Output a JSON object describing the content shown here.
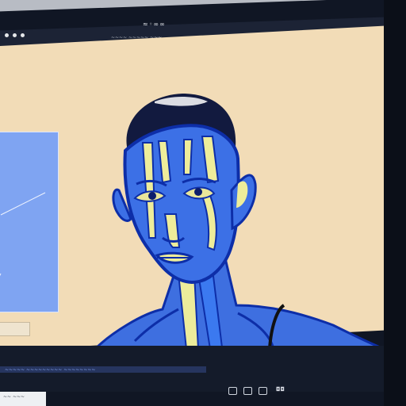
{
  "window": {
    "title": "≈◦∞∞",
    "menu": "~~~~ ~~~~~ ~~~"
  },
  "status": {
    "text": "~~~~~ ~~~~~~~~~ ~~~~~~~~"
  },
  "controls": {
    "label": "◘◘"
  },
  "sidepanel": {
    "label": ""
  },
  "bottomleft": {
    "text": "~~ ~~~"
  }
}
